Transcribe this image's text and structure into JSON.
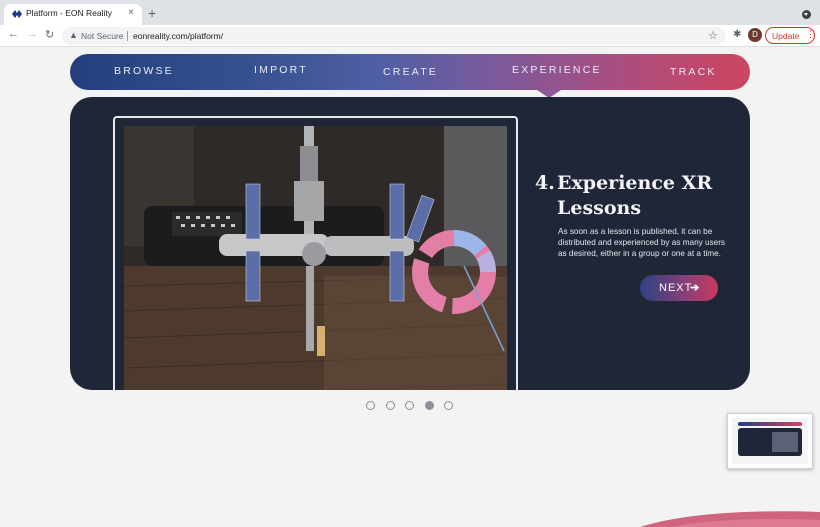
{
  "browser": {
    "tab_title": "Platform - EON Reality",
    "tab_close": "×",
    "new_tab": "+",
    "security_label": "Not Secure",
    "url": "eonreality.com/platform/",
    "avatar_letter": "D",
    "update_label": "Update",
    "back_icon": "←",
    "forward_icon": "→",
    "reload_icon": "↻",
    "star_icon": "☆",
    "extensions_icon": "✱",
    "menu_icon": "⋮",
    "warning_icon": "▲"
  },
  "nav": {
    "items": [
      "BROWSE",
      "IMPORT",
      "CREATE",
      "EXPERIENCE",
      "TRACK"
    ],
    "active_index": 3
  },
  "slide": {
    "number": "4.",
    "title_line1": "Experience XR",
    "title_line2": "Lessons",
    "description": "As soon as a lesson is published, it can be distributed and experienced by as many users as desired, either in a group or one at a time.",
    "next_label": "NEXT",
    "next_icon": "➔"
  },
  "pager": {
    "count": 5,
    "active_index": 3
  },
  "colors": {
    "panel_bg": "#1f2637",
    "nav_start": "#233f7e",
    "nav_end": "#cd4560",
    "update_red": "#d93025",
    "page_bg": "#f3f3f4"
  }
}
